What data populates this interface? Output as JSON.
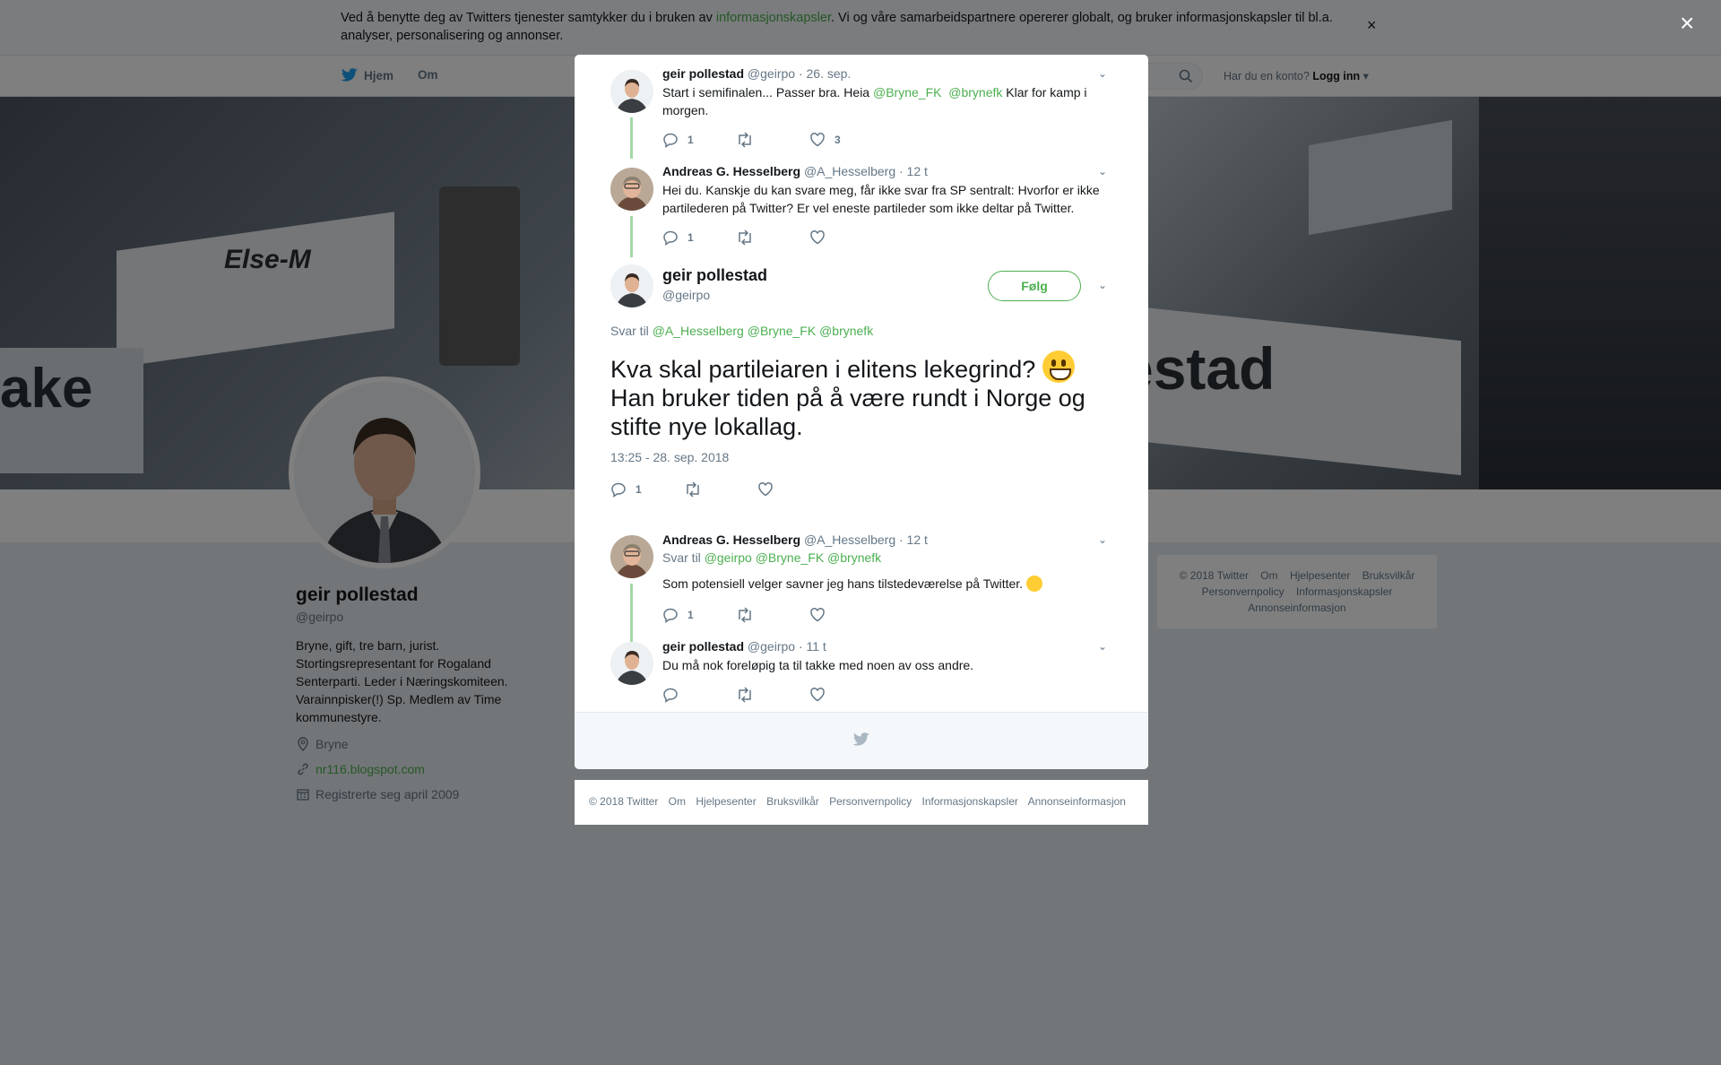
{
  "cookie_banner": {
    "text_before": "Ved å benytte deg av Twitters tjenester samtykker du i bruken av ",
    "link": "informasjonskapsler",
    "text_after": ". Vi og våre samarbeidspartnere opererer globalt, og bruker informasjonskapsler til bl.a. analyser, personalisering og annonser.",
    "close": "×"
  },
  "nav": {
    "home": "Hjem",
    "about": "Om",
    "login_prompt": "Har du en konto?",
    "login": "Logg inn"
  },
  "profile": {
    "name": "geir pollestad",
    "handle": "@geirpo",
    "bio": "Bryne, gift, tre barn, jurist. Stortingsrepresentant for Rogaland Senterparti. Leder i Næringskomiteen. Varainnpisker(!) Sp. Medlem av Time kommunestyre.",
    "location": "Bryne",
    "website": "nr116.blogspot.com",
    "joined": "Registrerte seg april 2009"
  },
  "right_footer": {
    "links": [
      "© 2018 Twitter",
      "Om",
      "Hjelpesenter",
      "Bruksvilkår",
      "Personvernpolicy",
      "Informasjonskapsler",
      "Annonseinformasjon"
    ]
  },
  "modal": {
    "close": "×",
    "tweets": [
      {
        "name": "geir pollestad",
        "handle": "@geirpo",
        "time": "· 26. sep.",
        "text_a": "Start i semifinalen... Passer bra. Heia ",
        "mention1": "@Bryne_FK",
        "mention2": "@brynefk",
        "text_b": " Klar for kamp i morgen.",
        "replies": "1",
        "likes": "3"
      },
      {
        "name": "Andreas G. Hesselberg",
        "handle": "@A_Hesselberg",
        "time": "· 12 t",
        "text": "Hei du. Kanskje du kan svare meg, får ikke svar fra SP sentralt: Hvorfor er ikke partilederen på Twitter? Er vel eneste partileder som ikke deltar på Twitter.",
        "replies": "1"
      }
    ],
    "main": {
      "name": "geir pollestad",
      "handle": "@geirpo",
      "follow": "Følg",
      "reply_to_label": "Svar til",
      "reply_to": "@A_Hesselberg @Bryne_FK @brynefk",
      "text": "Kva skal partileiaren i elitens lekegrind?",
      "text2": "Han bruker tiden på å være rundt i Norge og stifte nye lokallag.",
      "timestamp": "13:25 - 28. sep. 2018",
      "replies": "1"
    },
    "replies": [
      {
        "name": "Andreas G. Hesselberg",
        "handle": "@A_Hesselberg",
        "time": "· 12 t",
        "reply_to_label": "Svar til",
        "reply_to": "@geirpo @Bryne_FK @brynefk",
        "text": "Som potensiell velger savner jeg hans tilstedeværelse på Twitter.",
        "replies": "1"
      },
      {
        "name": "geir pollestad",
        "handle": "@geirpo",
        "time": "· 11 t",
        "text": "Du må nok foreløpig ta til takke med noen av oss andre."
      }
    ]
  },
  "modal_footer": {
    "links": [
      "© 2018 Twitter",
      "Om",
      "Hjelpesenter",
      "Bruksvilkår",
      "Personvernpolicy",
      "Informasjonskapsler",
      "Annonseinformasjon"
    ]
  },
  "colors": {
    "accent": "#4caf50",
    "thread_line": "#a4d8a6",
    "overlay": "rgba(0,0,0,0.5)"
  }
}
